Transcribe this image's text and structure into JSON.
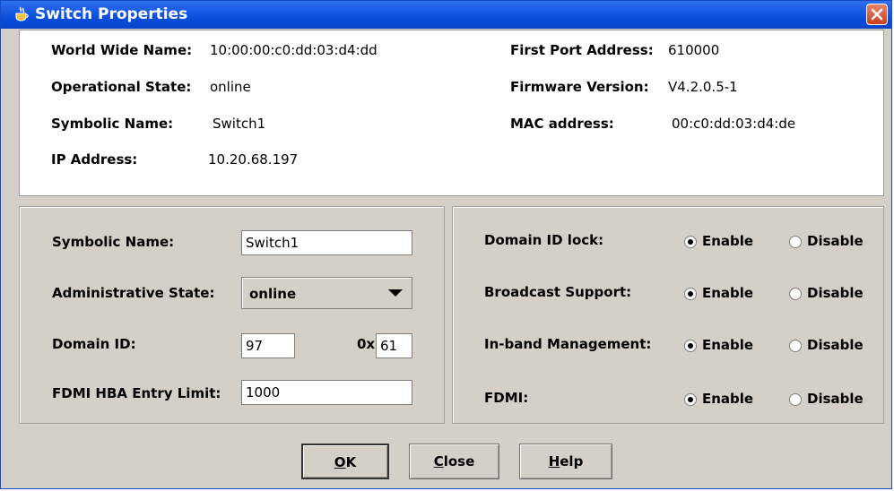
{
  "window": {
    "title": "Switch Properties"
  },
  "info": {
    "wwn_label": "World Wide Name:",
    "wwn_value": "10:00:00:c0:dd:03:d4:dd",
    "opstate_label": "Operational State:",
    "opstate_value": "online",
    "symname_label": "Symbolic Name:",
    "symname_value": "Switch1",
    "ip_label": "IP Address:",
    "ip_value": "10.20.68.197",
    "firstport_label": "First Port Address:",
    "firstport_value": "610000",
    "firmware_label": "Firmware Version:",
    "firmware_value": "V4.2.0.5-1",
    "mac_label": "MAC address:",
    "mac_value": "00:c0:dd:03:d4:de"
  },
  "settings": {
    "symname_label": "Symbolic Name:",
    "symname_value": "Switch1",
    "adminstate_label": "Administrative State:",
    "adminstate_value": "online",
    "domainid_label": "Domain ID:",
    "domainid_value": "97",
    "hex_prefix": "0x",
    "hex_value": "61",
    "fdmi_limit_label": "FDMI HBA Entry Limit:",
    "fdmi_limit_value": "1000"
  },
  "options": {
    "enable_label": "Enable",
    "disable_label": "Disable",
    "rows": [
      {
        "label": "Domain ID lock:",
        "selected": "Enable"
      },
      {
        "label": "Broadcast Support:",
        "selected": "Enable"
      },
      {
        "label": "In-band Management:",
        "selected": "Enable"
      },
      {
        "label": "FDMI:",
        "selected": "Enable"
      }
    ]
  },
  "buttons": {
    "ok_first": "O",
    "ok_rest": "K",
    "close_first": "C",
    "close_rest": "lose",
    "help_first": "H",
    "help_rest": "elp"
  }
}
